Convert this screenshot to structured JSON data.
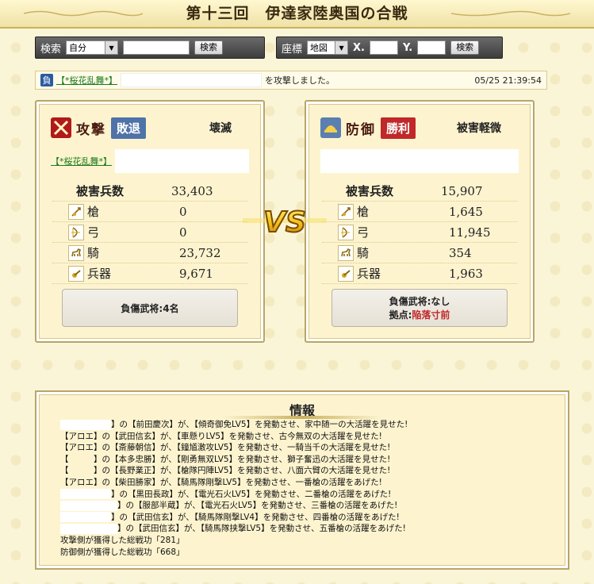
{
  "title": "第十三回　伊達家陸奥国の合戦",
  "search_left": {
    "label": "検索",
    "select_value": "自分",
    "button": "検索"
  },
  "search_right": {
    "label": "座標",
    "select_value": "地図",
    "x_label": "X.",
    "y_label": "Y.",
    "button": "検索"
  },
  "log": {
    "badge": "負",
    "attacker_link": "【*桜花乱舞*】",
    "message": "を攻撃しました。",
    "timestamp": "05/25 21:39:54"
  },
  "attack": {
    "role": "攻撃",
    "result": "敗退",
    "status": "壊滅",
    "alliance": "【*桜花乱舞*】",
    "stats": [
      {
        "label": "被害兵数",
        "value": "33,403",
        "icon": ""
      },
      {
        "label": "槍",
        "value": "0",
        "icon": "spear-icon"
      },
      {
        "label": "弓",
        "value": "0",
        "icon": "bow-icon"
      },
      {
        "label": "騎",
        "value": "23,732",
        "icon": "horse-icon"
      },
      {
        "label": "兵器",
        "value": "9,671",
        "icon": "siege-icon"
      }
    ],
    "info": "負傷武将:4名"
  },
  "defense": {
    "role": "防御",
    "result": "勝利",
    "status": "被害軽微",
    "stats": [
      {
        "label": "被害兵数",
        "value": "15,907",
        "icon": ""
      },
      {
        "label": "槍",
        "value": "1,645",
        "icon": "spear-icon"
      },
      {
        "label": "弓",
        "value": "11,945",
        "icon": "bow-icon"
      },
      {
        "label": "騎",
        "value": "354",
        "icon": "horse-icon"
      },
      {
        "label": "兵器",
        "value": "1,963",
        "icon": "siege-icon"
      }
    ],
    "info_line1": "負傷武将:なし",
    "info_line2_label": "拠点:",
    "info_line2_value": "陥落寸前"
  },
  "vs_text": "VS",
  "info_panel": {
    "title": "情報",
    "lines": [
      "】の【前田慶次】が、【傾奇御免LV5】を発動させ、家中随一の大活躍を見せた!",
      "【アロエ】の【武田信玄】が、【車懸りLV5】を発動させ、古今無双の大活躍を見せた!",
      "【アロエ】の【斎藤朝信】が、【鐘馗激攻LV5】を発動させ、一騎当千の大活躍を見せた!",
      "【　　　】の【本多忠勝】が、【剛勇無双LV5】を発動させ、獅子奮迅の大活躍を見せた!",
      "【　　　】の【長野業正】が、【槍隊円陣LV5】を発動させ、八面六臂の大活躍を見せた!",
      "【アロエ】の【柴田勝家】が、【騎馬隊剛撃LV5】を発動させ、一番槍の活躍をあげた!",
      "】の【黒田長政】が、【電光石火LV5】を発動させ、二番槍の活躍をあげた!",
      "】の【服部半蔵】が、【電光石火LV5】を発動させ、三番槍の活躍をあげた!",
      "】の【武田信玄】が、【騎馬隊剛撃LV4】を発動させ、四番槍の活躍をあげた!",
      "】の【武田信玄】が、【騎馬隊挟撃LV5】を発動させ、五番槍の活躍をあげた!",
      "攻撃側が獲得した総戦功「281」",
      "防御側が獲得した総戦功「668」"
    ]
  },
  "colors": {
    "lose_badge": "#4f73a8",
    "win_badge": "#c0282a",
    "link": "#1a7a1a",
    "frame": "#b9a56a"
  }
}
